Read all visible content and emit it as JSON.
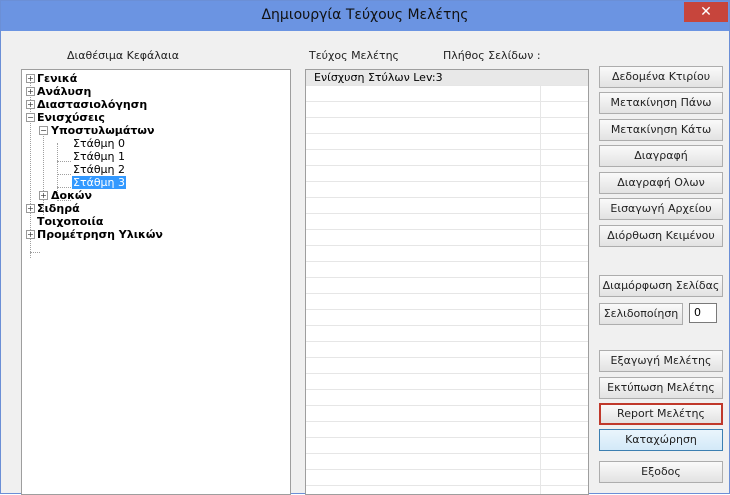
{
  "window": {
    "title": "Δημιουργία Τεύχους Μελέτης",
    "close_glyph": "✕",
    "accent": "#6b94e2",
    "close_bg": "#c7453c"
  },
  "headers": {
    "available_chapters": "Διαθέσιμα Κεφάλαια",
    "study_volume": "Τεύχος Μελέτης",
    "page_count_label": "Πλήθος Σελίδων :"
  },
  "tree": {
    "items": [
      {
        "label": "Γενικά",
        "bold": true,
        "expander": "+"
      },
      {
        "label": "Ανάλυση",
        "bold": true,
        "expander": "+"
      },
      {
        "label": "Διαστασιολόγηση",
        "bold": true,
        "expander": "+"
      },
      {
        "label": "Ενισχύσεις",
        "bold": true,
        "expander": "−"
      },
      {
        "label": "Υποστυλωμάτων",
        "bold": true,
        "expander": "−"
      },
      {
        "label": "Στάθμη 0",
        "bold": false
      },
      {
        "label": "Στάθμη 1",
        "bold": false
      },
      {
        "label": "Στάθμη 2",
        "bold": false
      },
      {
        "label": "Στάθμη 3",
        "bold": false,
        "selected": true
      },
      {
        "label": "Δοκών",
        "bold": true,
        "expander": "+"
      },
      {
        "label": "Σιδηρά",
        "bold": true,
        "expander": "+"
      },
      {
        "label": "Τοιχοποιία",
        "bold": true
      },
      {
        "label": "Προμέτρηση Υλικών",
        "bold": true,
        "expander": "+"
      }
    ]
  },
  "volume_list": {
    "rows": [
      "Ενίσχυση Στύλων Lev:3"
    ]
  },
  "buttons": {
    "building_data": "Δεδομένα Κτιρίου",
    "move_up": "Μετακίνηση Πάνω",
    "move_down": "Μετακίνηση Κάτω",
    "delete": "Διαγραφή",
    "delete_all": "Διαγραφή Ολων",
    "import_file": "Εισαγωγή Αρχείου",
    "edit_text": "Διόρθωση Κειμένου",
    "page_setup": "Διαμόρφωση Σελίδας",
    "pagination": "Σελιδοποίηση",
    "export_study": "Εξαγωγή Μελέτης",
    "print_study": "Εκτύπωση Μελέτης",
    "report_study": "Report Μελέτης",
    "register": "Καταχώρηση",
    "exit": "Εξοδος"
  },
  "pagination_value": "0"
}
